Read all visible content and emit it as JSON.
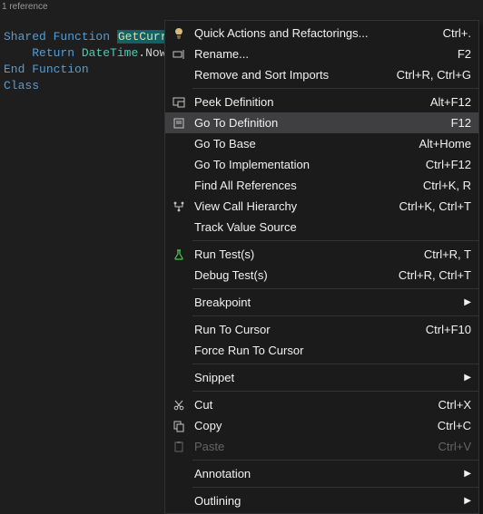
{
  "codelens": "1 reference",
  "code": {
    "line1_kw1": "Shared",
    "line1_kw2": "Function",
    "line1_fn": "GetCurre",
    "line2_indent": "    ",
    "line2_kw": "Return",
    "line2_type": "DateTime",
    "line2_dot": ".",
    "line2_prop": "Now",
    "line2_tail": ".",
    "line3_kw": "End",
    "line3_kw2": "Function",
    "line4_kw": "Class"
  },
  "menu": {
    "quick_actions": {
      "label": "Quick Actions and Refactorings...",
      "shortcut": "Ctrl+."
    },
    "rename": {
      "label": "Rename...",
      "shortcut": "F2"
    },
    "remove_sort": {
      "label": "Remove and Sort Imports",
      "shortcut": "Ctrl+R, Ctrl+G"
    },
    "peek_def": {
      "label": "Peek Definition",
      "shortcut": "Alt+F12"
    },
    "goto_def": {
      "label": "Go To Definition",
      "shortcut": "F12"
    },
    "goto_base": {
      "label": "Go To Base",
      "shortcut": "Alt+Home"
    },
    "goto_impl": {
      "label": "Go To Implementation",
      "shortcut": "Ctrl+F12"
    },
    "find_refs": {
      "label": "Find All References",
      "shortcut": "Ctrl+K, R"
    },
    "call_hier": {
      "label": "View Call Hierarchy",
      "shortcut": "Ctrl+K, Ctrl+T"
    },
    "track_value": {
      "label": "Track Value Source",
      "shortcut": ""
    },
    "run_tests": {
      "label": "Run Test(s)",
      "shortcut": "Ctrl+R, T"
    },
    "debug_tests": {
      "label": "Debug Test(s)",
      "shortcut": "Ctrl+R, Ctrl+T"
    },
    "breakpoint": {
      "label": "Breakpoint",
      "shortcut": ""
    },
    "run_cursor": {
      "label": "Run To Cursor",
      "shortcut": "Ctrl+F10"
    },
    "force_run": {
      "label": "Force Run To Cursor",
      "shortcut": ""
    },
    "snippet": {
      "label": "Snippet",
      "shortcut": ""
    },
    "cut": {
      "label": "Cut",
      "shortcut": "Ctrl+X"
    },
    "copy": {
      "label": "Copy",
      "shortcut": "Ctrl+C"
    },
    "paste": {
      "label": "Paste",
      "shortcut": "Ctrl+V"
    },
    "annotation": {
      "label": "Annotation",
      "shortcut": ""
    },
    "outlining": {
      "label": "Outlining",
      "shortcut": ""
    }
  }
}
